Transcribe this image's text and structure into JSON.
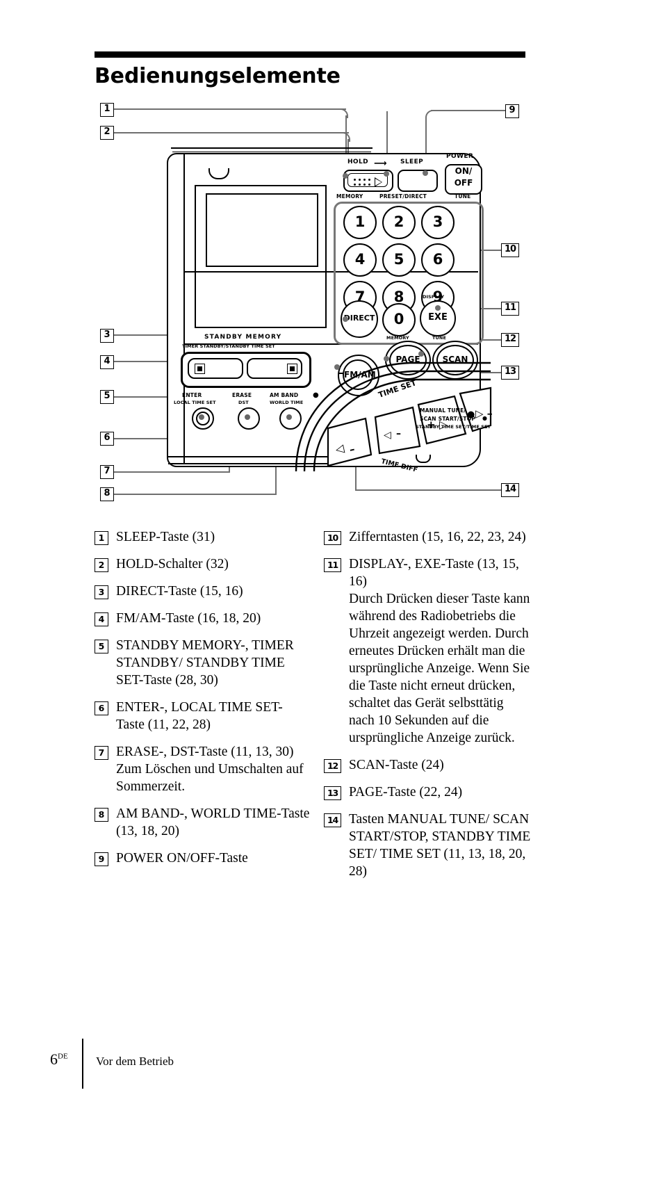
{
  "page": {
    "title": "Bedienungselemente",
    "footer_page_number": "6",
    "footer_page_suffix": "DE",
    "footer_section": "Vor dem Betrieb"
  },
  "diagram": {
    "callout_numbers": [
      "1",
      "2",
      "3",
      "4",
      "5",
      "6",
      "7",
      "8",
      "9",
      "10",
      "11",
      "12",
      "13",
      "14"
    ],
    "device_labels": {
      "hold": "HOLD",
      "sleep": "SLEEP",
      "power": "POWER",
      "power_on": "ON/",
      "power_off": "OFF",
      "memory": "MEMORY",
      "preset_direct": "PRESET/DIRECT",
      "tune": "TUNE",
      "direct": "DIRECT",
      "display": "DISPLAY",
      "exe": "EXE",
      "memory2": "MEMORY",
      "tune2": "TUNE",
      "page": "PAGE",
      "scan": "SCAN",
      "fm_am": "FM/AM",
      "standby_memory": "STANDBY  MEMORY",
      "timer_standby": "TIMER STANDBY/STANDBY TIME SET",
      "enter": "ENTER",
      "local_time_set": "LOCAL TIME SET",
      "erase": "ERASE",
      "dst": "DST",
      "am_band": "AM BAND",
      "world_time": "WORLD TIME",
      "time_set": "TIME SET",
      "time_diff": "TIME DIFF",
      "manual_tune": "MANUAL TUNE/",
      "scan_start_stop": "SCAN START/STOP",
      "standby_time_set": "STANDBY  TIME SET/TIME SET",
      "plus": "+",
      "minus": "–"
    },
    "keypad": [
      "1",
      "2",
      "3",
      "4",
      "5",
      "6",
      "7",
      "8",
      "9",
      "0"
    ]
  },
  "legend": {
    "left": [
      {
        "num": "1",
        "lines": [
          "SLEEP-Taste (31)"
        ]
      },
      {
        "num": "2",
        "lines": [
          "HOLD-Schalter (32)"
        ]
      },
      {
        "num": "3",
        "lines": [
          "DIRECT-Taste (15, 16)"
        ]
      },
      {
        "num": "4",
        "lines": [
          "FM/AM-Taste (16, 18, 20)"
        ]
      },
      {
        "num": "5",
        "lines": [
          "STANDBY MEMORY-, TIMER STANDBY/ STANDBY TIME SET-Taste (28, 30)"
        ]
      },
      {
        "num": "6",
        "lines": [
          "ENTER-, LOCAL TIME SET-Taste (11, 22, 28)"
        ]
      },
      {
        "num": "7",
        "lines": [
          "ERASE-, DST-Taste (11, 13, 30)",
          "Zum Löschen und Umschalten auf Sommerzeit."
        ]
      },
      {
        "num": "8",
        "lines": [
          "AM BAND-, WORLD TIME-Taste (13, 18, 20)"
        ]
      },
      {
        "num": "9",
        "lines": [
          "POWER ON/OFF-Taste"
        ]
      }
    ],
    "right": [
      {
        "num": "10",
        "lines": [
          "Zifferntasten (15, 16, 22, 23, 24)"
        ]
      },
      {
        "num": "11",
        "lines": [
          "DISPLAY-, EXE-Taste (13, 15, 16)",
          "Durch Drücken dieser Taste kann während des Radiobetriebs die Uhrzeit angezeigt werden. Durch erneutes Drücken erhält man die ursprüngliche Anzeige. Wenn Sie die Taste nicht erneut drücken, schaltet das Gerät selbsttätig nach 10 Sekunden auf die ursprüngliche Anzeige zurück."
        ]
      },
      {
        "num": "12",
        "lines": [
          "SCAN-Taste (24)"
        ]
      },
      {
        "num": "13",
        "lines": [
          "PAGE-Taste (22, 24)"
        ]
      },
      {
        "num": "14",
        "lines": [
          "Tasten MANUAL TUNE/ SCAN START/STOP, STANDBY TIME SET/ TIME SET (11, 13, 18, 20, 28)"
        ]
      }
    ]
  }
}
